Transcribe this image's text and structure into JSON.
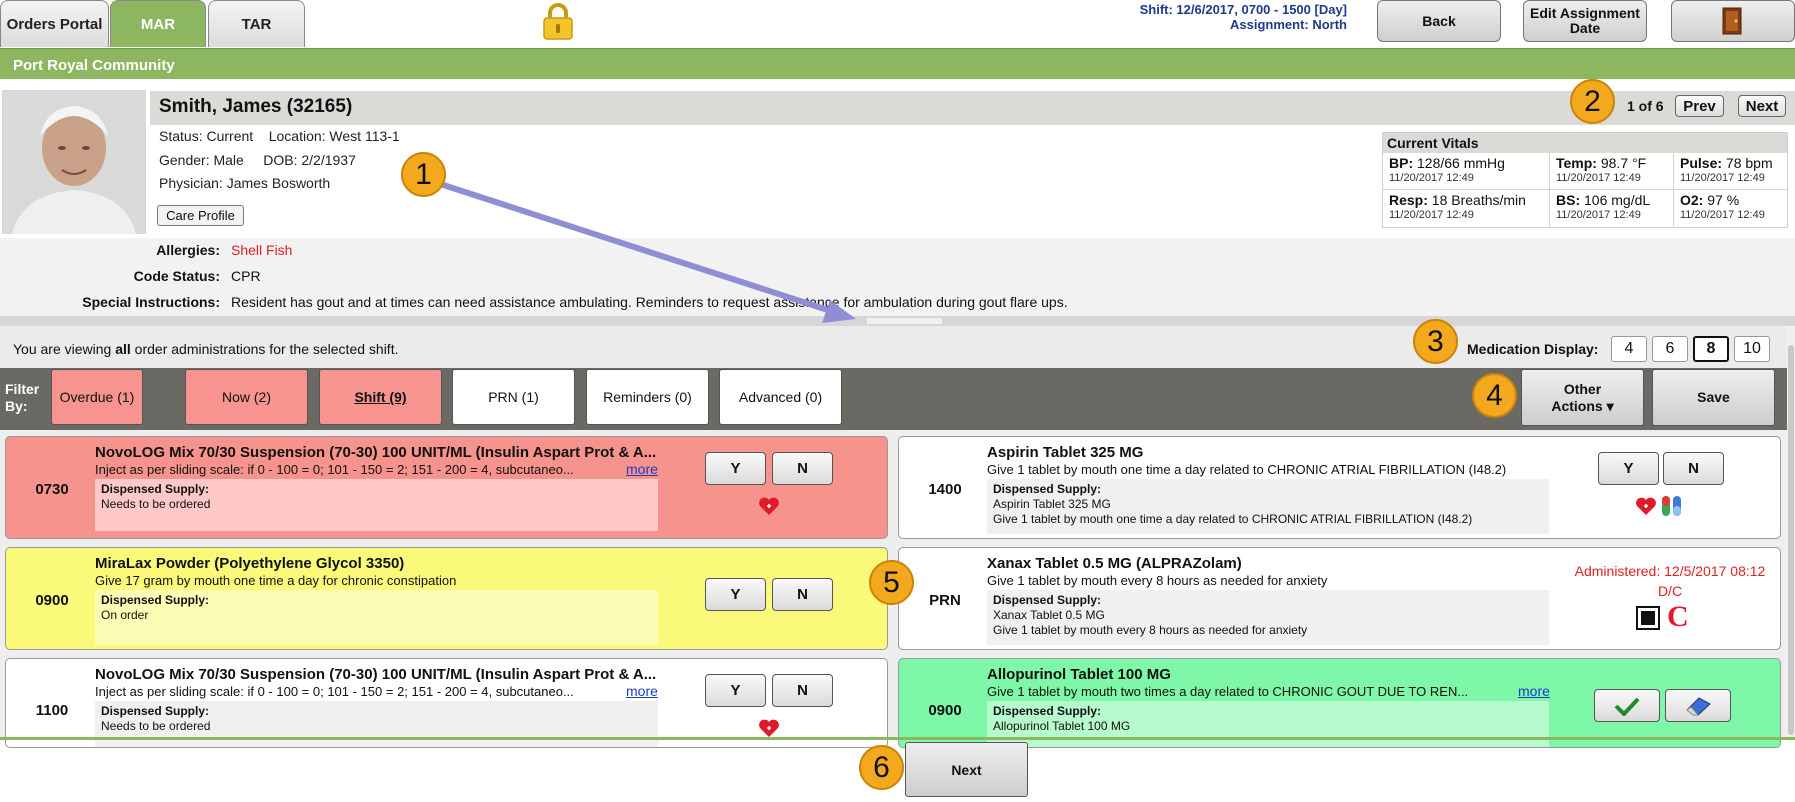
{
  "tabs": [
    {
      "label": "Orders Portal",
      "active": false
    },
    {
      "label": "MAR",
      "active": true
    },
    {
      "label": "TAR",
      "active": false
    }
  ],
  "lock_icon": "padlock-icon",
  "shift_line": "Shift: 12/6/2017, 0700 - 1500 [Day]",
  "assignment_line": "Assignment: North",
  "top_buttons": {
    "back": "Back",
    "edit_assignment": "Edit Assignment Date",
    "exit_icon": "exit-door-icon"
  },
  "community": "Port Royal Community",
  "patient": {
    "name": "Smith, James (32165)",
    "status_line": "Status: Current    Location: West 113-1",
    "gender_line": "Gender: Male     DOB: 2/2/1937",
    "physician_line": "Physician: James Bosworth",
    "care_profile": "Care Profile"
  },
  "pager": {
    "position": "1 of 6",
    "prev": "Prev",
    "next": "Next"
  },
  "vitals": {
    "title": "Current Vitals",
    "items": [
      {
        "label": "BP:",
        "value": "128/66 mmHg",
        "date": "11/20/2017 12:49"
      },
      {
        "label": "Temp:",
        "value": "98.7 °F",
        "date": "11/20/2017 12:49"
      },
      {
        "label": "Pulse:",
        "value": "78 bpm",
        "date": "11/20/2017 12:49"
      },
      {
        "label": "Resp:",
        "value": "18 Breaths/min",
        "date": "11/20/2017 12:49"
      },
      {
        "label": "BS:",
        "value": "106 mg/dL",
        "date": "11/20/2017 12:49"
      },
      {
        "label": "O2:",
        "value": "97 %",
        "date": "11/20/2017 12:49"
      }
    ]
  },
  "info": {
    "allergies_label": "Allergies:",
    "allergies_value": "Shell Fish",
    "code_status_label": "Code Status:",
    "code_status_value": "CPR",
    "special_label": "Special Instructions:",
    "special_value": "Resident has gout and at times can need assistance ambulating. Reminders to request assistance for ambulation during gout flare ups."
  },
  "viewing": {
    "prefix": "You are viewing ",
    "bold": "all",
    "suffix": " order administrations for the selected shift."
  },
  "med_display": {
    "label": "Medication Display:",
    "options": [
      "4",
      "6",
      "8",
      "10"
    ],
    "selected": "8"
  },
  "filter": {
    "label_1": "Filter",
    "label_2": "By:",
    "buttons": [
      "Overdue (1)",
      "Now (2)",
      "Shift (9)",
      "PRN (1)",
      "Reminders (0)",
      "Advanced (0)"
    ],
    "selected": "Shift (9)"
  },
  "actions": {
    "other": "Other",
    "other_2": "Actions ▾",
    "save": "Save"
  },
  "supply_title": "Dispensed Supply:",
  "more_label": "more",
  "yn": {
    "y": "Y",
    "n": "N"
  },
  "meds": [
    {
      "time": "0730",
      "name": "NovoLOG Mix 70/30 Suspension (70-30) 100 UNIT/ML (Insulin Aspart Prot & A...",
      "desc": "Inject as per sliding scale: if 0 - 100 = 0; 101 - 150 = 2; 151 - 200 = 4, subcutaneo...",
      "supply": [
        "Needs to be ordered"
      ],
      "color": "red"
    },
    {
      "time": "1400",
      "name": "Aspirin Tablet 325 MG",
      "desc": "Give 1 tablet by mouth one time a day related to CHRONIC ATRIAL FIBRILLATION (I48.2)",
      "supply": [
        "Aspirin Tablet 325 MG",
        "Give 1 tablet by mouth one time a day related to CHRONIC ATRIAL FIBRILLATION (I48.2)"
      ],
      "color": "white"
    },
    {
      "time": "0900",
      "name": "MiraLax Powder (Polyethylene Glycol 3350)",
      "desc": "Give 17 gram by mouth one time a day for chronic constipation",
      "supply": [
        "On order"
      ],
      "color": "yellow"
    },
    {
      "time": "PRN",
      "name": "Xanax Tablet 0.5 MG (ALPRAZolam)",
      "desc": "Give 1 tablet by mouth every 8 hours as needed for anxiety",
      "supply": [
        "Xanax Tablet 0.5 MG",
        "Give 1 tablet by mouth every 8 hours as needed for anxiety"
      ],
      "color": "white",
      "administered": "Administered: 12/5/2017 08:12",
      "dc": "D/C",
      "c_mark": "C"
    },
    {
      "time": "1100",
      "name": "NovoLOG Mix 70/30 Suspension (70-30) 100 UNIT/ML (Insulin Aspart Prot & A...",
      "desc": "Inject as per sliding scale: if 0 - 100 = 0; 101 - 150 = 2; 151 - 200 = 4, subcutaneo...",
      "supply": [
        "Needs to be ordered"
      ],
      "color": "white"
    },
    {
      "time": "0900",
      "name": "Allopurinol Tablet 100 MG",
      "desc": "Give 1 tablet by mouth two times a day related to CHRONIC GOUT DUE TO REN...",
      "supply": [
        "Allopurinol Tablet 100 MG"
      ],
      "color": "green"
    }
  ],
  "bottom_next": "Next",
  "callouts": [
    "1",
    "2",
    "3",
    "4",
    "5",
    "6"
  ],
  "colors": {
    "green": "#8db660",
    "red_card": "#f7938d",
    "yellow_card": "#fbf979",
    "green_card": "#7ff7a8",
    "callout": "#f4a81d",
    "arrow": "#8f8ed4"
  }
}
